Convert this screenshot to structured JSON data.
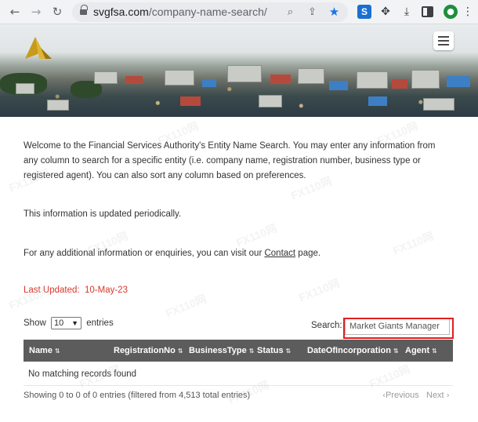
{
  "browser": {
    "url_domain": "svgfsa.com",
    "url_path": "/company-name-search/",
    "icons": {
      "back": "arrow-left-icon",
      "forward": "arrow-right-icon",
      "reload": "reload-icon",
      "lock": "lock-icon",
      "zoom": "magnifier-icon",
      "share": "share-icon",
      "bookmark": "star-icon",
      "extension_s": "S",
      "extensions": "puzzle-icon",
      "downloads": "download-icon",
      "layout": "side-panel-icon",
      "profile": "avatar-icon"
    }
  },
  "page": {
    "intro": "Welcome to the Financial Services Authority's Entity Name Search. You may enter any information from any column to search for a specific entity (i.e. company name, registration number, business type or registered agent). You can also sort any column based on preferences.",
    "updated_note": "This information is updated periodically.",
    "contact_prefix": "For any additional information or enquiries, you can visit our ",
    "contact_link": "Contact",
    "contact_suffix": " page.",
    "last_updated_label": "Last Updated:",
    "last_updated_value": "10-May-23"
  },
  "table": {
    "show_label": "Show",
    "page_size": "10",
    "entries_label": "entries",
    "search_label": "Search:",
    "search_value": "Market Giants Manager",
    "columns": [
      "Name",
      "RegistrationNo",
      "BusinessType",
      "Status",
      "DateOfIncorporation",
      "Agent"
    ],
    "empty_message": "No matching records found",
    "info": "Showing 0 to 0 of 0 entries (filtered from 4,513 total entries)",
    "previous": "Previous",
    "next": "Next"
  },
  "watermark": "FX110网",
  "colors": {
    "alert": "#d9362b",
    "table_header": "#5c5c5c",
    "highlight": "#e02020",
    "bookmark": "#1a73e8"
  }
}
